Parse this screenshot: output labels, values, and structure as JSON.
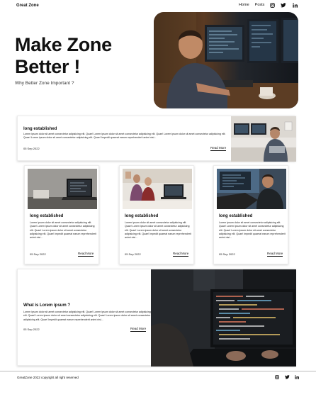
{
  "nav": {
    "brand": "Great Zone",
    "links": [
      "Home",
      "Posts"
    ],
    "icons": [
      "instagram-icon",
      "twitter-icon",
      "linkedin-icon"
    ]
  },
  "hero": {
    "title_line1": "Make Zone",
    "title_line2": "Better !",
    "subtitle": "Why Better Zone Important ?"
  },
  "cards": {
    "wide1": {
      "title": "long established",
      "body": "Lorem ipsum dolor sit amet consectetur adipisicing elit. Quae! Lorem ipsum dolor sit amet consectetur adipisicing elit. Quae! Lorem ipsum dolor sit amet consectetur adipisicing elit. Quae! Lorem ipsum dolor sit amet consectetur adipisicing elit. Quae! Impedit quaerat earum reprehenderit animi nisi...",
      "date": "05 Sep 2022",
      "more": "Read More"
    },
    "small": [
      {
        "title": "long established",
        "body": "Lorem ipsum dolor sit amet consectetur adipisicing elit. Quae! Lorem ipsum dolor sit amet consectetur adipisicing elit. Quae! Lorem ipsum dolor sit amet consectetur adipisicing elit. Quae! Impedit quaerat earum reprehenderit animi nisi...",
        "date": "05 Sep 2022",
        "more": "Read More"
      },
      {
        "title": "long established",
        "body": "Lorem ipsum dolor sit amet consectetur adipisicing elit. Quae! Lorem ipsum dolor sit amet consectetur adipisicing elit. Quae! Lorem ipsum dolor sit amet consectetur adipisicing elit. Quae! Impedit quaerat earum reprehenderit animi nisi...",
        "date": "05 Sep 2022",
        "more": "Read More"
      },
      {
        "title": "long established",
        "body": "Lorem ipsum dolor sit amet consectetur adipisicing elit. Quae! Lorem ipsum dolor sit amet consectetur adipisicing elit. Quae! Lorem ipsum dolor sit amet consectetur adipisicing elit. Quae! Impedit quaerat earum reprehenderit animi nisi...",
        "date": "05 Sep 2022",
        "more": "Read More"
      }
    ],
    "wide2": {
      "title": "What is Lorem ipsum ?",
      "body": "Lorem ipsum dolor sit amet consectetur adipisicing elit. Quae! Lorem ipsum dolor sit amet consectetur adipisicing elit. Quae! Lorem ipsum dolor sit amet consectetur adipisicing elit. Quae! Lorem ipsum dolor sit amet consectetur adipisicing elit. Quae! Impedit quaerat earum reprehenderit animi nisi...",
      "date": "05 Sep 2022",
      "more": "Read More"
    }
  },
  "footer": {
    "text": "GreatZone 2022 copyright all right reserved",
    "icons": [
      "instagram-icon",
      "twitter-icon",
      "linkedin-icon"
    ]
  }
}
